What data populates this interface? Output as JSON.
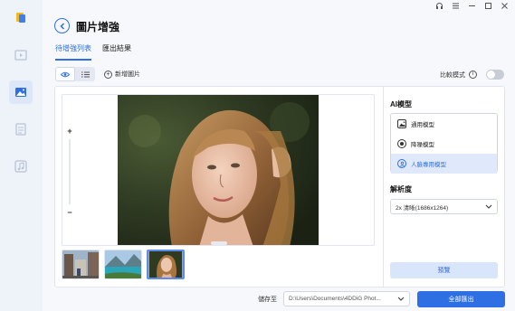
{
  "window": {
    "controls": [
      "headset-icon",
      "menu-icon",
      "minimize-icon",
      "maximize-icon",
      "close-icon"
    ],
    "accent": "#2f6fe4"
  },
  "sidebar": {
    "items": [
      "app-logo-icon",
      "video-icon",
      "image-icon",
      "document-icon",
      "music-icon"
    ],
    "active_index": 2
  },
  "header": {
    "title": "圖片增強"
  },
  "tabs": [
    {
      "label": "待增強列表",
      "active": true
    },
    {
      "label": "匯出結果",
      "active": false
    }
  ],
  "toolbar": {
    "add_label": "新增圖片",
    "compare_label": "比較模式"
  },
  "preview": {
    "zoom_in": "+",
    "zoom_out": "−"
  },
  "right_panel": {
    "model_label": "AI模型",
    "models": [
      {
        "label": "通用模型",
        "icon": "image-icon",
        "selected": false
      },
      {
        "label": "降噪模型",
        "icon": "denoise-icon",
        "selected": false
      },
      {
        "label": "人臉專用模型",
        "icon": "face-icon",
        "selected": true
      }
    ],
    "resolution_label": "解析度",
    "resolution_value": "2x 清晰(1686x1264)",
    "preview_button": "預覽"
  },
  "bottom": {
    "save_label": "儲存至",
    "path_value": "D:\\Users\\Documents\\4DDiG Phot...",
    "export_button": "全部匯出"
  }
}
